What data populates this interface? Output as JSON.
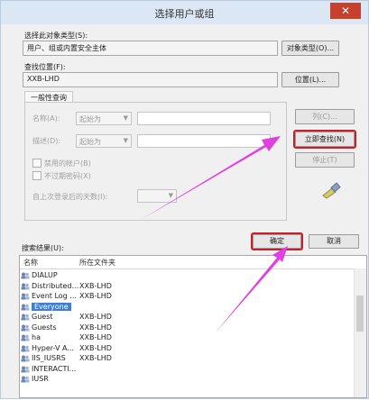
{
  "window": {
    "title": "选择用户或组",
    "close_glyph": "✕"
  },
  "object_type": {
    "label": "选择此对象类型(S):",
    "value": "用户、组或内置安全主体",
    "button": "对象类型(O)..."
  },
  "location": {
    "label": "查找位置(F):",
    "value": "XXB-LHD",
    "button": "位置(L)..."
  },
  "general_queries": {
    "tab": "一般性查询",
    "name_label": "名称(A):",
    "name_mode": "起始为",
    "desc_label": "描述(D):",
    "desc_mode": "起始为",
    "disabled_accounts": "禁用的帐户(B)",
    "non_expiring_password": "不过期密码(X)",
    "days_since_logon": "自上次登录后的天数(I):"
  },
  "side_buttons": {
    "columns": "列(C)...",
    "find_now": "立即查找(N)",
    "stop": "停止(T)"
  },
  "footer": {
    "results_label": "搜索结果(U):",
    "ok": "确定",
    "cancel": "取消"
  },
  "results": {
    "columns": [
      "名称",
      "所在文件夹"
    ],
    "rows": [
      {
        "name": "DIALUP",
        "folder": ""
      },
      {
        "name": "Distributed...",
        "folder": "XXB-LHD"
      },
      {
        "name": "Event Log ...",
        "folder": "XXB-LHD"
      },
      {
        "name": "Everyone",
        "folder": ""
      },
      {
        "name": "Guest",
        "folder": "XXB-LHD"
      },
      {
        "name": "Guests",
        "folder": "XXB-LHD"
      },
      {
        "name": "ha",
        "folder": "XXB-LHD"
      },
      {
        "name": "Hyper-V A...",
        "folder": "XXB-LHD"
      },
      {
        "name": "IIS_IUSRS",
        "folder": "XXB-LHD"
      },
      {
        "name": "INTERACTI...",
        "folder": ""
      },
      {
        "name": "IUSR",
        "folder": ""
      }
    ],
    "selected_index": 3
  },
  "colors": {
    "highlight_box": "#c8202a",
    "annotation_arrow": "#e040e0",
    "selection": "#3c7fd9"
  }
}
